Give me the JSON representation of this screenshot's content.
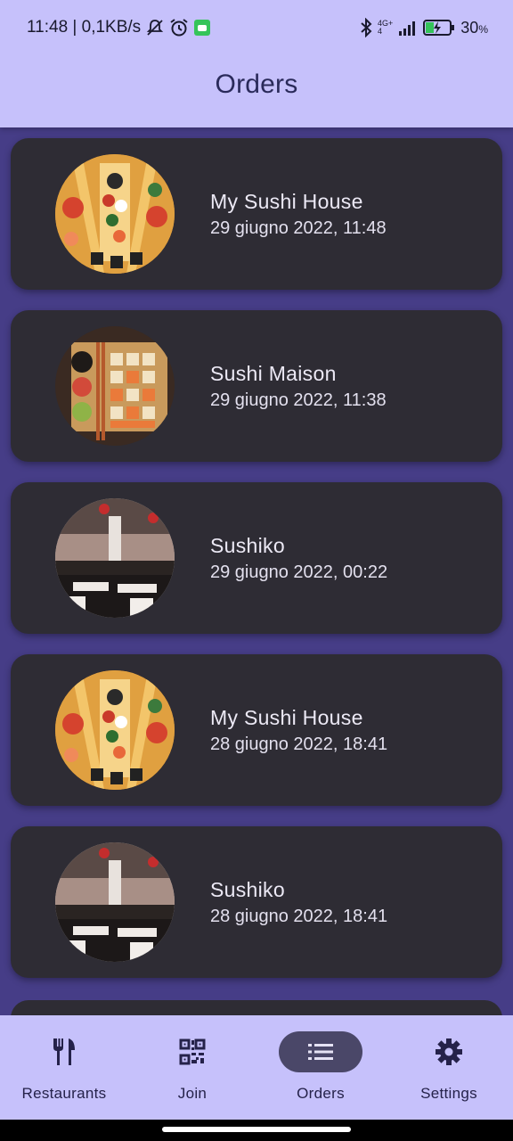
{
  "status_bar": {
    "time_speed": "11:48 | 0,1KB/s",
    "network_top": "4G+",
    "network_bottom": "4",
    "battery_pct": "30",
    "battery_unit": "%"
  },
  "app_bar": {
    "title": "Orders"
  },
  "orders": [
    {
      "restaurant": "My Sushi House",
      "datetime": "29 giugno 2022, 11:48",
      "image": "sushi-boat-platter"
    },
    {
      "restaurant": "Sushi Maison",
      "datetime": "29 giugno 2022, 11:38",
      "image": "sushi-tray-box"
    },
    {
      "restaurant": "Sushiko",
      "datetime": "29 giugno 2022, 00:22",
      "image": "restaurant-interior"
    },
    {
      "restaurant": "My Sushi House",
      "datetime": "28 giugno 2022, 18:41",
      "image": "sushi-boat-platter"
    },
    {
      "restaurant": "Sushiko",
      "datetime": "28 giugno 2022, 18:41",
      "image": "restaurant-interior"
    }
  ],
  "bottom_nav": {
    "items": [
      {
        "label": "Restaurants",
        "icon": "fork-knife-icon"
      },
      {
        "label": "Join",
        "icon": "qr-code-icon"
      },
      {
        "label": "Orders",
        "icon": "list-icon",
        "active": true
      },
      {
        "label": "Settings",
        "icon": "gear-icon"
      }
    ]
  },
  "colors": {
    "bars": "#c6c1fb",
    "background": "#463d87",
    "card": "#2e2c34",
    "active_pill": "#4a4768"
  }
}
